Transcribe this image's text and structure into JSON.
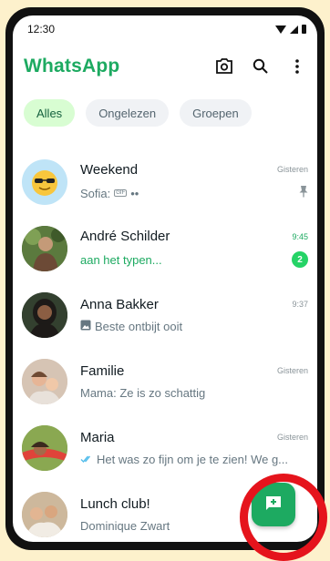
{
  "status_bar": {
    "time": "12:30"
  },
  "header": {
    "title": "WhatsApp",
    "title_color": "#1daa61"
  },
  "filters": [
    "Alles",
    "Ongelezen",
    "Groepen"
  ],
  "chats": [
    {
      "name": "Weekend",
      "time": "Gisteren",
      "preview_sender": "Sofia:",
      "preview": "GIF",
      "extra": "••",
      "pinned": true
    },
    {
      "name": "André Schilder",
      "time": "9:45",
      "preview": "aan het typen...",
      "unread_count": "2",
      "typing": true
    },
    {
      "name": "Anna Bakker",
      "time": "9:37",
      "preview": "Beste ontbijt ooit",
      "has_photo_icon": true
    },
    {
      "name": "Familie",
      "time": "Gisteren",
      "preview": "Mama: Ze is zo schattig"
    },
    {
      "name": "Maria",
      "time": "Gisteren",
      "preview": "Het was zo fijn om je te zien! We g...",
      "read_receipt": true
    },
    {
      "name": "Lunch club!",
      "time": "",
      "preview": "Dominique Zwart"
    }
  ],
  "colors": {
    "accent": "#1daa61",
    "badge": "#25d366",
    "highlight": "#e5141c"
  }
}
